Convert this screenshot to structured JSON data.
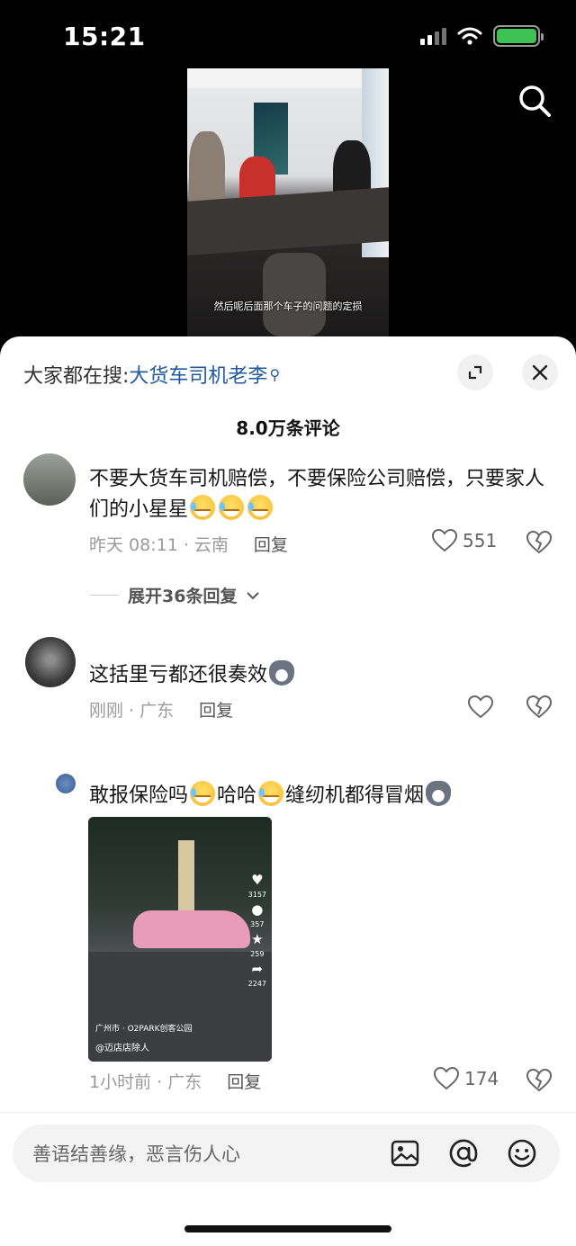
{
  "status_bar": {
    "time": "15:21"
  },
  "video": {
    "subtitle": "然后呢后面那个车子的问题的定损"
  },
  "panel": {
    "trending_prefix": "大家都在搜:",
    "trending_keyword": "大货车司机老李",
    "comment_count": "8.0万条评论"
  },
  "comments": [
    {
      "text": "不要大货车司机赔偿，不要保险公司赔偿，只要家人们的小星星",
      "emojis": [
        "cry-laugh",
        "cry-laugh",
        "cry-laugh"
      ],
      "time_location": "昨天 08:11 · 云南",
      "reply_label": "回复",
      "like_count": "551",
      "expand_replies": "展开36条回复"
    },
    {
      "text": "这括里亏都还很奏效",
      "emojis": [
        "husky"
      ],
      "time_location": "刚刚 · 广东",
      "reply_label": "回复"
    },
    {
      "text_parts": [
        "敢报保险吗",
        "哈哈",
        "缝纫机都得冒烟"
      ],
      "emojis": [
        "cry-laugh",
        "cry-laugh",
        "husky"
      ],
      "time_location": "1小时前 · 广东",
      "reply_label": "回复",
      "like_count": "174",
      "video": {
        "location": "广州市 · O2PARK创客公园",
        "author": "@迈店店除人",
        "likes": "3157",
        "comments": "357",
        "favorites": "259",
        "shares": "2247"
      }
    }
  ],
  "input": {
    "placeholder": "善语结善缘，恶言伤人心"
  },
  "icons": [
    "search-icon",
    "expand-icon",
    "close-icon",
    "heart-icon",
    "broken-heart-icon",
    "image-icon",
    "at-icon",
    "emoji-icon",
    "chevron-down-icon"
  ]
}
